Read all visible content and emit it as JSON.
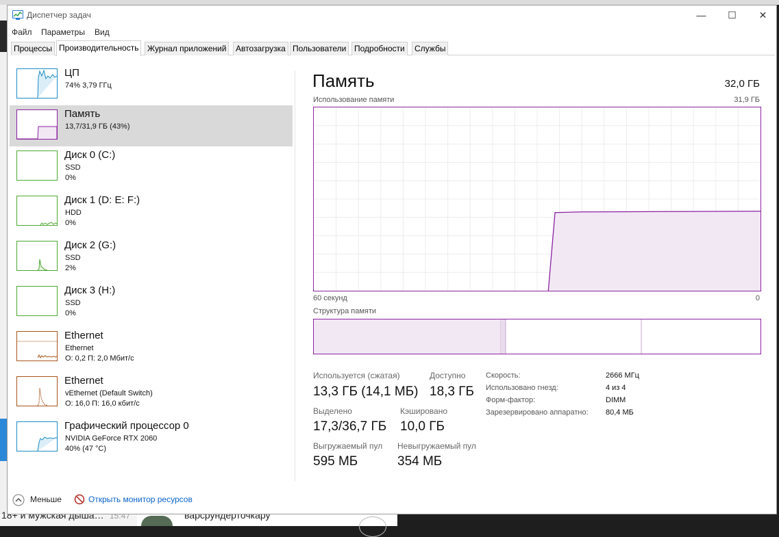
{
  "background": {
    "bottom_text_left": "18+ и мужская дыша…",
    "bottom_time": "15:47",
    "bottom_text_mid": "варсрундерточкару"
  },
  "window": {
    "title": "Диспетчер задач",
    "menu": [
      "Файл",
      "Параметры",
      "Вид"
    ],
    "tabs": [
      "Процессы",
      "Производительность",
      "Журнал приложений",
      "Автозагрузка",
      "Пользователи",
      "Подробности",
      "Службы"
    ],
    "active_tab": "Производительность"
  },
  "sidebar": [
    {
      "title": "ЦП",
      "line2": "74% 3,79 ГГц",
      "line3": "",
      "color": "#1b8bc3"
    },
    {
      "title": "Память",
      "line2": "13,7/31,9 ГБ (43%)",
      "line3": "",
      "color": "#8b22a0",
      "selected": true
    },
    {
      "title": "Диск 0 (C:)",
      "line2": "SSD",
      "line3": "0%",
      "color": "#4da832"
    },
    {
      "title": "Диск 1 (D: E: F:)",
      "line2": "HDD",
      "line3": "0%",
      "color": "#4da832"
    },
    {
      "title": "Диск 2 (G:)",
      "line2": "SSD",
      "line3": "2%",
      "color": "#4da832"
    },
    {
      "title": "Диск 3 (H:)",
      "line2": "SSD",
      "line3": "0%",
      "color": "#4da832"
    },
    {
      "title": "Ethernet",
      "line2": "Ethernet",
      "line3": "О: 0,2  П: 2,0 Мбит/с",
      "color": "#a7531a"
    },
    {
      "title": "Ethernet",
      "line2": "vEthernet (Default Switch)",
      "line3": "О: 16,0  П: 16,0 кбит/с",
      "color": "#a7531a"
    },
    {
      "title": "Графический процессор 0",
      "line2": "NVIDIA GeForce RTX 2060",
      "line3": "40%  (47 °C)",
      "color": "#1b8bc3"
    }
  ],
  "main": {
    "title": "Память",
    "total": "32,0 ГБ",
    "usage_label": "Использование памяти",
    "usage_max": "31,9 ГБ",
    "time_left": "60 секунд",
    "time_right": "0",
    "structure_label": "Структура памяти",
    "accent": "#8b22a0",
    "usage_fraction_now": 0.43,
    "stats": {
      "in_use_label": "Используется (сжатая)",
      "in_use_value": "13,3 ГБ (14,1 МБ)",
      "available_label": "Доступно",
      "available_value": "18,3 ГБ",
      "committed_label": "Выделено",
      "committed_value": "17,3/36,7 ГБ",
      "cached_label": "Кэшировано",
      "cached_value": "10,0 ГБ",
      "paged_label": "Выгружаемый пул",
      "paged_value": "595 МБ",
      "nonpaged_label": "Невыгружаемый пул",
      "nonpaged_value": "354 МБ"
    },
    "details": [
      {
        "label": "Скорость:",
        "value": "2666 МГц"
      },
      {
        "label": "Использовано гнезд:",
        "value": "4 из 4"
      },
      {
        "label": "Форм-фактор:",
        "value": "DIMM"
      },
      {
        "label": "Зарезервировано аппаратно:",
        "value": "80,4 МБ"
      }
    ]
  },
  "footer": {
    "less": "Меньше",
    "monitor_link": "Открыть монитор ресурсов"
  }
}
